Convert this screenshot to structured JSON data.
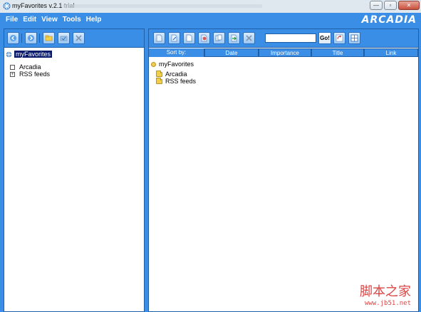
{
  "window": {
    "title": "myFavorites v.2.1 trial"
  },
  "menu": {
    "items": [
      "File",
      "Edit",
      "View",
      "Tools",
      "Help"
    ]
  },
  "brand": {
    "logo": "ARCADIA"
  },
  "left_toolbar": {
    "icons": [
      "back-icon",
      "forward-icon",
      "new-folder-icon",
      "open-folder-icon",
      "delete-icon"
    ]
  },
  "right_toolbar": {
    "icons": [
      "page-icon",
      "edit-page-icon",
      "blank-page-icon",
      "web-page-icon",
      "copy-page-icon",
      "move-page-icon",
      "delete-icon"
    ],
    "search_value": "",
    "go_label": "Go!",
    "extra_icons": [
      "refresh-icon",
      "grid-icon"
    ]
  },
  "list_header": {
    "sort_label": "Sort by:",
    "columns": [
      "Date",
      "Importance",
      "Title",
      "Link"
    ]
  },
  "left_tree": {
    "root": "myFavorites",
    "children": [
      {
        "label": "Arcadia",
        "expander": ""
      },
      {
        "label": "RSS feeds",
        "expander": "+"
      }
    ]
  },
  "right_tree": {
    "root": "myFavorites",
    "children": [
      "Arcadia",
      "RSS feeds"
    ]
  },
  "watermark": {
    "line1": "脚本之家",
    "line2": "www.jb51.net"
  },
  "colors": {
    "accent": "#3a8ee6",
    "border": "#1e5fa8",
    "selection": "#0a1a6a"
  }
}
